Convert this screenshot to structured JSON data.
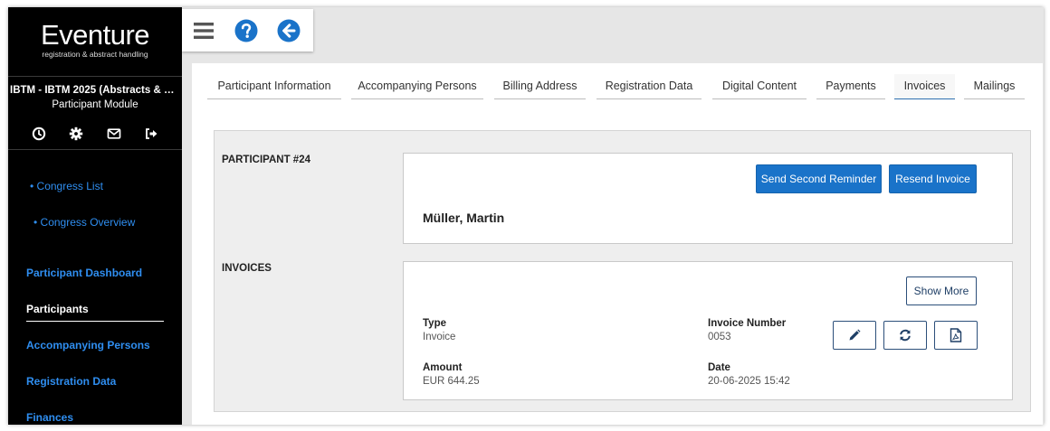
{
  "brand": {
    "name": "Eventure",
    "tagline": "registration & abstract handling"
  },
  "sidebar": {
    "congress_name": "IBTM - IBTM 2025 (Abstracts & Par...",
    "module_name": "Participant Module",
    "icons": [
      "clock-icon",
      "gear-icon",
      "envelope-icon",
      "sign-out-icon"
    ],
    "links": [
      {
        "label": "• Congress List"
      },
      {
        "label": "• Congress Overview"
      },
      {
        "label": "Participant Dashboard"
      },
      {
        "label": "Participants"
      },
      {
        "label": "Accompanying Persons"
      },
      {
        "label": "Registration Data"
      },
      {
        "label": "Finances"
      }
    ]
  },
  "toolbar": {
    "icons": [
      "menu-icon",
      "help-icon",
      "back-arrow-icon"
    ]
  },
  "tabs": [
    {
      "label": "Participant Information"
    },
    {
      "label": "Accompanying Persons"
    },
    {
      "label": "Billing Address"
    },
    {
      "label": "Registration Data"
    },
    {
      "label": "Digital Content"
    },
    {
      "label": "Payments"
    },
    {
      "label": "Invoices"
    },
    {
      "label": "Mailings"
    }
  ],
  "active_tab": "Invoices",
  "participant": {
    "section_label": "PARTICIPANT #24",
    "name": "Müller, Martin",
    "send_second_reminder_label": "Send Second Reminder",
    "resend_invoice_label": "Resend Invoice"
  },
  "invoices": {
    "section_label": "INVOICES",
    "show_more_label": "Show More",
    "items": [
      {
        "type_label": "Type",
        "type_value": "Invoice",
        "number_label": "Invoice Number",
        "number_value": "0053",
        "amount_label": "Amount",
        "amount_value": "EUR 644.25",
        "date_label": "Date",
        "date_value": "20-06-2025 15:42"
      }
    ],
    "action_icons": [
      "edit-icon",
      "refresh-icon",
      "pdf-icon"
    ]
  },
  "colors": {
    "primary": "#1a73c9",
    "sidebar_bg": "#000000",
    "link": "#2f8ef0",
    "outline": "#2c4f7a"
  }
}
